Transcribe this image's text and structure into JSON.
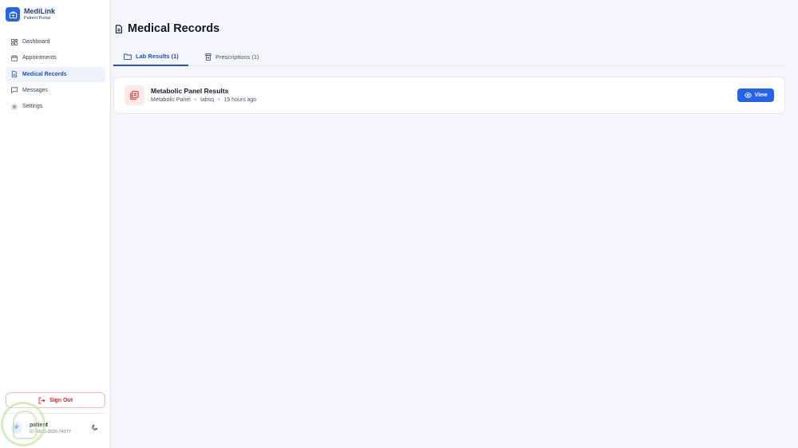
{
  "brand": {
    "title": "MediLink",
    "subtitle": "Patient Portal"
  },
  "nav": [
    {
      "label": "Dashboard",
      "icon": "dashboard-grid-icon"
    },
    {
      "label": "Appointments",
      "icon": "calendar-icon"
    },
    {
      "label": "Medical Records",
      "icon": "document-icon",
      "active": true
    },
    {
      "label": "Messages",
      "icon": "chat-icon"
    },
    {
      "label": "Settings",
      "icon": "gear-icon"
    }
  ],
  "sign_out_label": "Sign Out",
  "user": {
    "avatar_letter": "P",
    "name": "patient",
    "id": "ID: MED-2026-74177"
  },
  "page": {
    "title": "Medical Records"
  },
  "tabs": [
    {
      "label": "Lab Results (1)",
      "active": true
    },
    {
      "label": "Prescriptions (1)",
      "active": false
    }
  ],
  "records": [
    {
      "title": "Metabolic Panel Results",
      "type": "Metabolic Panel",
      "source": "labsq",
      "time": "19 hours ago",
      "action_label": "View"
    }
  ],
  "colors": {
    "accent": "#2563eb",
    "danger": "#dc2626",
    "active_bg": "#eef3fb"
  }
}
